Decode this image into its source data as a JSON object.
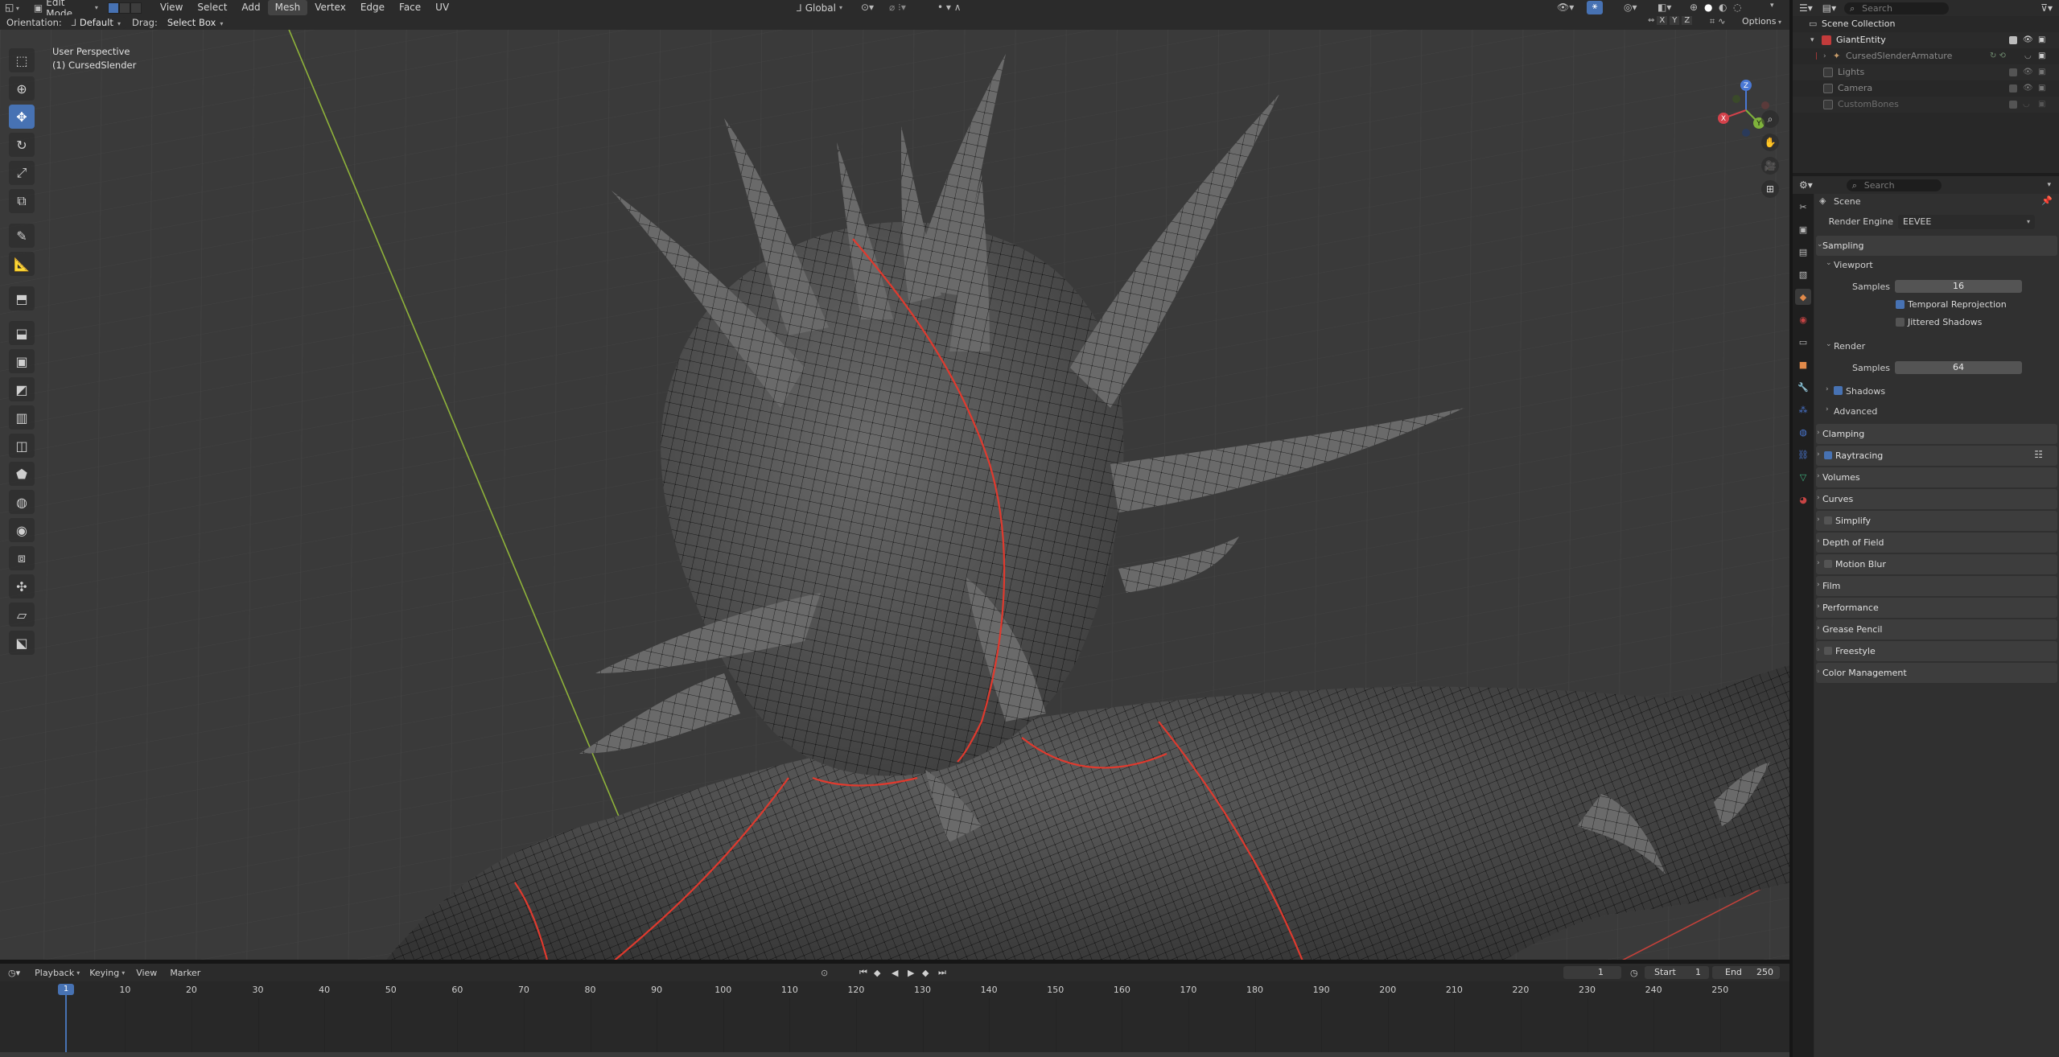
{
  "header": {
    "mode": "Edit Mode",
    "menus": [
      "View",
      "Select",
      "Add",
      "Mesh",
      "Vertex",
      "Edge",
      "Face",
      "UV"
    ],
    "active_menu": "Mesh",
    "transform_orientation": "Global"
  },
  "tool_settings": {
    "orientation_label": "Orientation:",
    "orientation_value": "Default",
    "drag_label": "Drag:",
    "drag_value": "Select Box",
    "axis_x": "X",
    "axis_y": "Y",
    "axis_z": "Z",
    "options": "Options"
  },
  "viewport": {
    "view_name": "User Perspective",
    "object_name": "(1) CursedSlender",
    "gizmo": {
      "x": "X",
      "y": "Y",
      "z": "Z"
    }
  },
  "toolbar": {
    "tools": [
      "select-box",
      "cursor",
      "move",
      "rotate",
      "scale",
      "transform",
      "annotate",
      "measure",
      "add-cube",
      "extrude",
      "inset",
      "bevel",
      "loop-cut",
      "knife",
      "poly-build",
      "spin",
      "smooth",
      "edge-slide",
      "shrink-fatten",
      "shear",
      "rip-region"
    ],
    "active_tool": "move"
  },
  "outliner": {
    "search_placeholder": "Search",
    "items": [
      {
        "label": "Scene Collection",
        "indent": 0
      },
      {
        "label": "GiantEntity",
        "indent": 1
      },
      {
        "label": "CursedSlenderArmature",
        "indent": 2
      },
      {
        "label": "Lights",
        "indent": 1
      },
      {
        "label": "Camera",
        "indent": 1
      },
      {
        "label": "CustomBones",
        "indent": 1
      }
    ]
  },
  "properties": {
    "search_placeholder": "Search",
    "context": "Scene",
    "render_engine_label": "Render Engine",
    "render_engine_value": "EEVEE",
    "sampling": "Sampling",
    "viewport": "Viewport",
    "samples_label": "Samples",
    "viewport_samples": "16",
    "temporal_reprojection": "Temporal Reprojection",
    "jittered_shadows": "Jittered Shadows",
    "render": "Render",
    "render_samples": "64",
    "shadows": "Shadows",
    "advanced": "Advanced",
    "panels": [
      "Clamping",
      "Raytracing",
      "Volumes",
      "Curves",
      "Simplify",
      "Depth of Field",
      "Motion Blur",
      "Film",
      "Performance",
      "Grease Pencil",
      "Freestyle",
      "Color Management"
    ]
  },
  "timeline": {
    "menus": [
      "Playback",
      "Keying",
      "View",
      "Marker"
    ],
    "current_frame": "1",
    "start_label": "Start",
    "start": "1",
    "end_label": "End",
    "end": "250",
    "ticks": [
      "10",
      "20",
      "30",
      "40",
      "50",
      "60",
      "70",
      "80",
      "90",
      "100",
      "110",
      "120",
      "130",
      "140",
      "150",
      "160",
      "170",
      "180",
      "190",
      "200",
      "210",
      "220",
      "230",
      "240",
      "250"
    ],
    "playhead": "1"
  },
  "colors": {
    "accent": "#4772b3",
    "seam": "#e03a2e",
    "mesh": "#6b6b6b",
    "grid_axis_y": "#8fb33a",
    "grid_axis_x": "#c2413a"
  }
}
